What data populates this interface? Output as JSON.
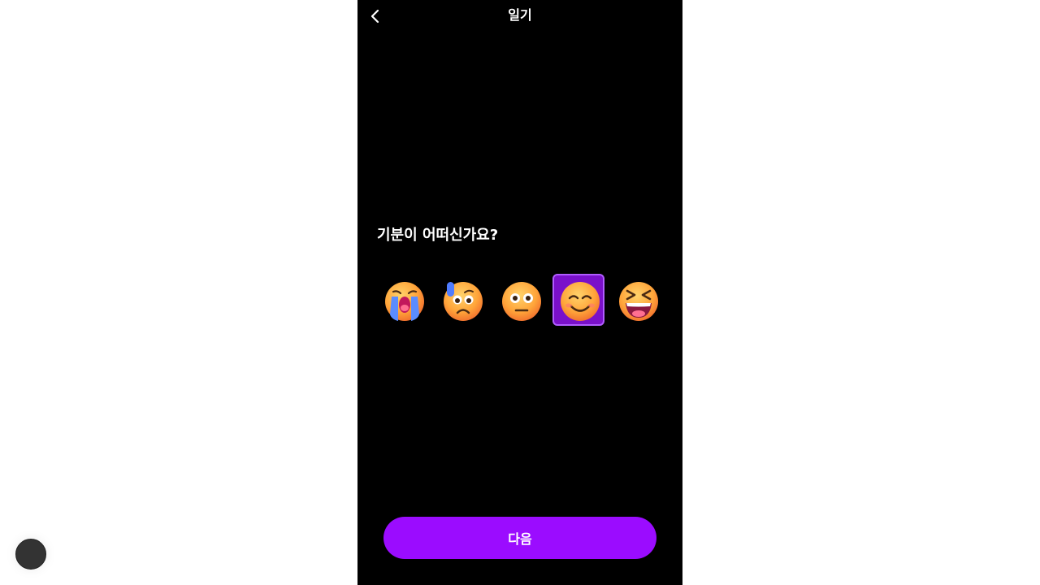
{
  "header": {
    "title": "일기",
    "back_icon": "chevron-left-icon"
  },
  "main": {
    "question": "기분이 어떠신가요?",
    "moods": [
      {
        "name": "loudly-crying",
        "icon": "loudly-crying-face-icon",
        "selected": false
      },
      {
        "name": "anxious-sweat",
        "icon": "anxious-face-with-sweat-icon",
        "selected": false
      },
      {
        "name": "neutral",
        "icon": "neutral-face-icon",
        "selected": false
      },
      {
        "name": "smiling",
        "icon": "smiling-face-icon",
        "selected": true
      },
      {
        "name": "grinning-squinting",
        "icon": "grinning-squinting-face-icon",
        "selected": false
      }
    ]
  },
  "footer": {
    "next_label": "다음"
  },
  "colors": {
    "background": "#000000",
    "accent": "#9b0cff",
    "selected_bg": "#7a10c9",
    "selected_border": "#b15cff"
  }
}
